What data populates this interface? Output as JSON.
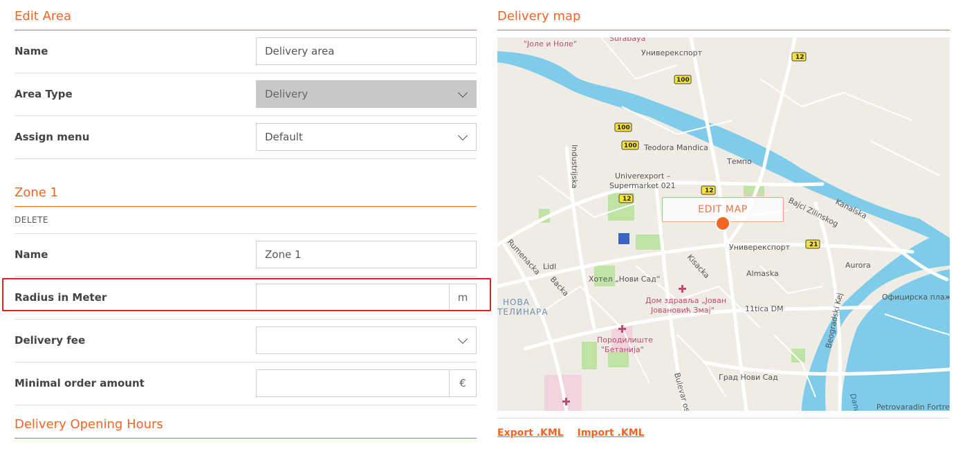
{
  "edit_area": {
    "title": "Edit Area",
    "name": {
      "label": "Name",
      "value": "Delivery area"
    },
    "area_type": {
      "label": "Area Type",
      "value": "Delivery"
    },
    "assign_menu": {
      "label": "Assign menu",
      "value": "Default"
    }
  },
  "zone": {
    "title": "Zone 1",
    "delete_label": "DELETE",
    "name": {
      "label": "Name",
      "value": "Zone 1"
    },
    "radius": {
      "label": "Radius in Meter",
      "value": "",
      "unit": "m"
    },
    "delivery_fee": {
      "label": "Delivery fee",
      "value": ""
    },
    "minimal_order": {
      "label": "Minimal order amount",
      "value": "",
      "unit": "€"
    }
  },
  "opening_hours": {
    "title": "Delivery Opening Hours"
  },
  "map": {
    "title": "Delivery map",
    "edit_button": "EDIT MAP",
    "export_link": "Export .KML",
    "import_link": "Import .KML",
    "labels": {
      "surabaya": "Surabaya",
      "jole_nole": "\"Јоле и Ноле\"",
      "univerexport_top": "Универекспорт",
      "teodora": "Teodora Mandica",
      "tempo": "Темпо",
      "industrijska": "Industrijska",
      "univerexport_sm1": "Univerexport –",
      "univerexport_sm2": "Supermarket 021",
      "bajci": "Bajci Zilinskog",
      "kanalska": "Kanalska",
      "univerexport_mid": "Универекспорт",
      "rumenacka": "Rumenacka",
      "lidl": "Lidl",
      "backa": "Backa",
      "kisacka": "Kisacka",
      "almaska": "Almaska",
      "aurora": "Aurora",
      "hotel": "Хотел „Нови Сад“",
      "dom1": "Дом здравља „Јован",
      "dom2": "Јовановић Змај“",
      "nova": "НОВА",
      "telinara": "ТЕЛИНАРА",
      "tica": "11tica DM",
      "beogradski": "Beogradski Kej",
      "oficirska": "Официрска плажа",
      "porod1": "Породилиште",
      "porod2": "\"Бетанија\"",
      "bulevar": "Bulevar os",
      "grad": "Град Нови Сад",
      "danube": "Danu",
      "petrovaradin": "Petrovaradin Fortres",
      "r12a": "12",
      "r100a": "100",
      "r100b": "100",
      "r100c": "100",
      "r12b": "12",
      "r12c": "12",
      "r21": "21"
    }
  },
  "colors": {
    "accent": "#f26522",
    "highlight": "#e02020",
    "water": "#7ecbea",
    "park": "#bfe3a4"
  }
}
